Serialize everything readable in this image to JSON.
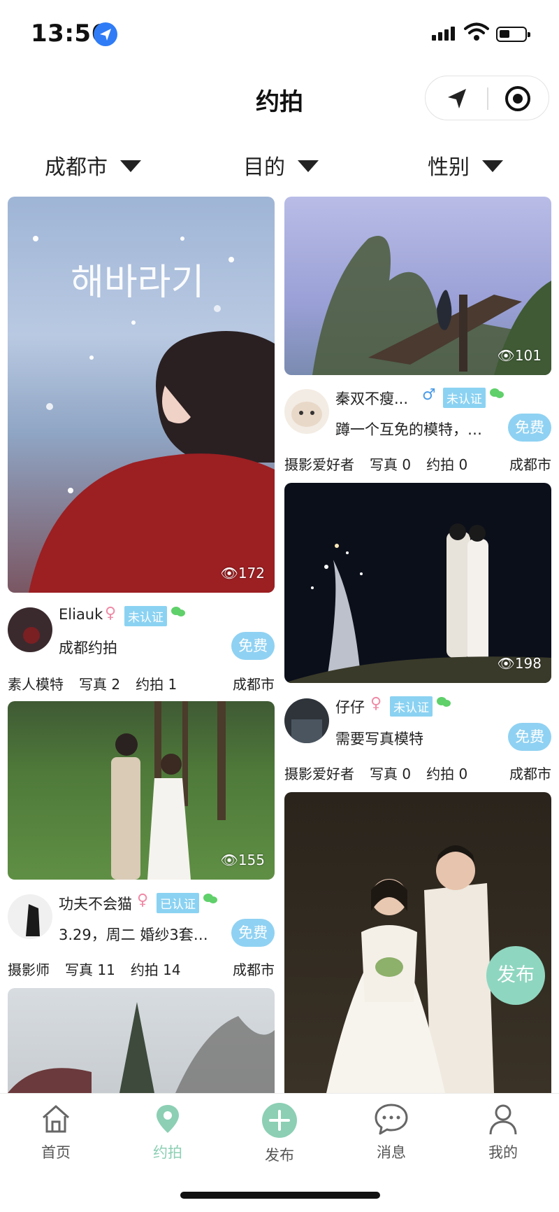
{
  "status_bar": {
    "time": "13:56"
  },
  "header": {
    "title": "约拍"
  },
  "filters": [
    {
      "label": "成都市"
    },
    {
      "label": "目的"
    },
    {
      "label": "性别"
    }
  ],
  "cards": [
    {
      "views": "172",
      "user": "Eliauk",
      "gender": "♀",
      "badge": "未认证",
      "desc": "成都约拍",
      "price": "免费",
      "role": "素人模特",
      "photos": "写真 2",
      "shoots": "约拍 1",
      "city": "成都市"
    },
    {
      "views": "101",
      "user": "秦双不瘦...",
      "gender": "♂",
      "badge": "未认证",
      "desc": "蹲一个互免的模特，我...",
      "price": "免费",
      "role": "摄影爱好者",
      "photos": "写真 0",
      "shoots": "约拍 0",
      "city": "成都市"
    },
    {
      "views": "198",
      "user": "仔仔",
      "gender": "♀",
      "badge": "未认证",
      "desc": "需要写真模特",
      "price": "免费",
      "role": "摄影爱好者",
      "photos": "写真 0",
      "shoots": "约拍 0",
      "city": "成都市"
    },
    {
      "views": "155",
      "user": "功夫不会猫",
      "gender": "♀",
      "badge": "已认证",
      "desc": "3.29，周二 婚纱3套互...",
      "price": "免费",
      "role": "摄影师",
      "photos": "写真 11",
      "shoots": "约拍 14",
      "city": "成都市"
    }
  ],
  "fab": {
    "label": "发布"
  },
  "tabs": [
    {
      "label": "首页",
      "icon": "home-icon"
    },
    {
      "label": "约拍",
      "icon": "location-pin-icon"
    },
    {
      "label": "发布",
      "icon": "plus-circle-icon"
    },
    {
      "label": "消息",
      "icon": "chat-bubble-icon"
    },
    {
      "label": "我的",
      "icon": "user-icon"
    }
  ],
  "colors": {
    "accent": "#8fd6c0",
    "badge": "#8bd2f2",
    "free": "#8fd1f2",
    "female": "#f08aa6",
    "male": "#4a9be8",
    "wechat": "#5fd06a"
  }
}
